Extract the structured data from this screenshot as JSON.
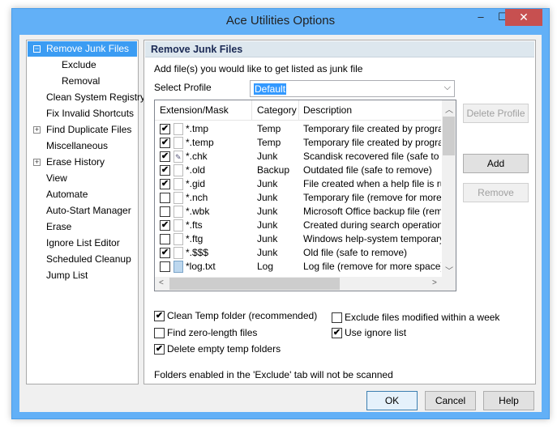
{
  "window": {
    "title": "Ace Utilities Options",
    "minimize": "–",
    "maximize": "☐",
    "close": "✕"
  },
  "sidebar": {
    "items": [
      {
        "label": "Remove Junk Files",
        "expander": "−",
        "selected": true,
        "level": 0
      },
      {
        "label": "Exclude",
        "level": 1
      },
      {
        "label": "Removal",
        "level": 1
      },
      {
        "label": "Clean System Registry",
        "level": 0
      },
      {
        "label": "Fix Invalid Shortcuts",
        "level": 0
      },
      {
        "label": "Find Duplicate Files",
        "expander": "+",
        "level": 0
      },
      {
        "label": "Miscellaneous",
        "level": 0
      },
      {
        "label": "Erase History",
        "expander": "+",
        "level": 0
      },
      {
        "label": "View",
        "level": 0
      },
      {
        "label": "Automate",
        "level": 0
      },
      {
        "label": "Auto-Start Manager",
        "level": 0
      },
      {
        "label": "Erase",
        "level": 0
      },
      {
        "label": "Ignore List Editor",
        "level": 0
      },
      {
        "label": "Scheduled Cleanup",
        "level": 0
      },
      {
        "label": "Jump List",
        "level": 0
      }
    ]
  },
  "panel": {
    "header": "Remove Junk Files",
    "intro": "Add file(s) you would like to get listed as junk file",
    "profile_label": "Select Profile",
    "profile_value": "Default",
    "columns": [
      "Extension/Mask",
      "Category",
      "Description"
    ],
    "rows": [
      {
        "checked": true,
        "icon": "file",
        "mask": "*.tmp",
        "category": "Temp",
        "description": "Temporary file created by programs"
      },
      {
        "checked": true,
        "icon": "file",
        "mask": "*.temp",
        "category": "Temp",
        "description": "Temporary file created by programs"
      },
      {
        "checked": true,
        "icon": "chk-file",
        "mask": "*.chk",
        "category": "Junk",
        "description": "Scandisk recovered file (safe to remove)"
      },
      {
        "checked": true,
        "icon": "file",
        "mask": "*.old",
        "category": "Backup",
        "description": "Outdated file (safe to remove)"
      },
      {
        "checked": true,
        "icon": "file",
        "mask": "*.gid",
        "category": "Junk",
        "description": "File created when a help file is run ("
      },
      {
        "checked": false,
        "icon": "file",
        "mask": "*.nch",
        "category": "Junk",
        "description": "Temporary file (remove for more space)"
      },
      {
        "checked": false,
        "icon": "file",
        "mask": "*.wbk",
        "category": "Junk",
        "description": "Microsoft Office backup file (remove"
      },
      {
        "checked": true,
        "icon": "file",
        "mask": "*.fts",
        "category": "Junk",
        "description": "Created during search operations w"
      },
      {
        "checked": false,
        "icon": "file",
        "mask": "*.ftg",
        "category": "Junk",
        "description": "Windows help-system temporary file"
      },
      {
        "checked": true,
        "icon": "file",
        "mask": "*.$$$",
        "category": "Junk",
        "description": "Old file (safe to remove)"
      },
      {
        "checked": false,
        "icon": "text-file",
        "mask": "*log.txt",
        "category": "Log",
        "description": "Log file (remove for more space)"
      }
    ],
    "buttons": {
      "delete_profile": "Delete Profile",
      "add": "Add",
      "remove": "Remove"
    },
    "options": {
      "clean_temp": {
        "label": "Clean Temp folder (recommended)",
        "checked": true
      },
      "find_zero": {
        "label": "Find zero-length files",
        "checked": false
      },
      "delete_empty": {
        "label": "Delete empty temp folders",
        "checked": true
      },
      "exclude_week": {
        "label": "Exclude files modified within a week",
        "checked": false
      },
      "ignore_list": {
        "label": "Use ignore list",
        "checked": true
      }
    },
    "footer_note": "Folders enabled in the 'Exclude' tab will not be scanned"
  },
  "dialog_buttons": {
    "ok": "OK",
    "cancel": "Cancel",
    "help": "Help"
  },
  "colors": {
    "titlebar": "#62b0f7",
    "selection": "#3b9cf3",
    "close": "#c75050"
  }
}
